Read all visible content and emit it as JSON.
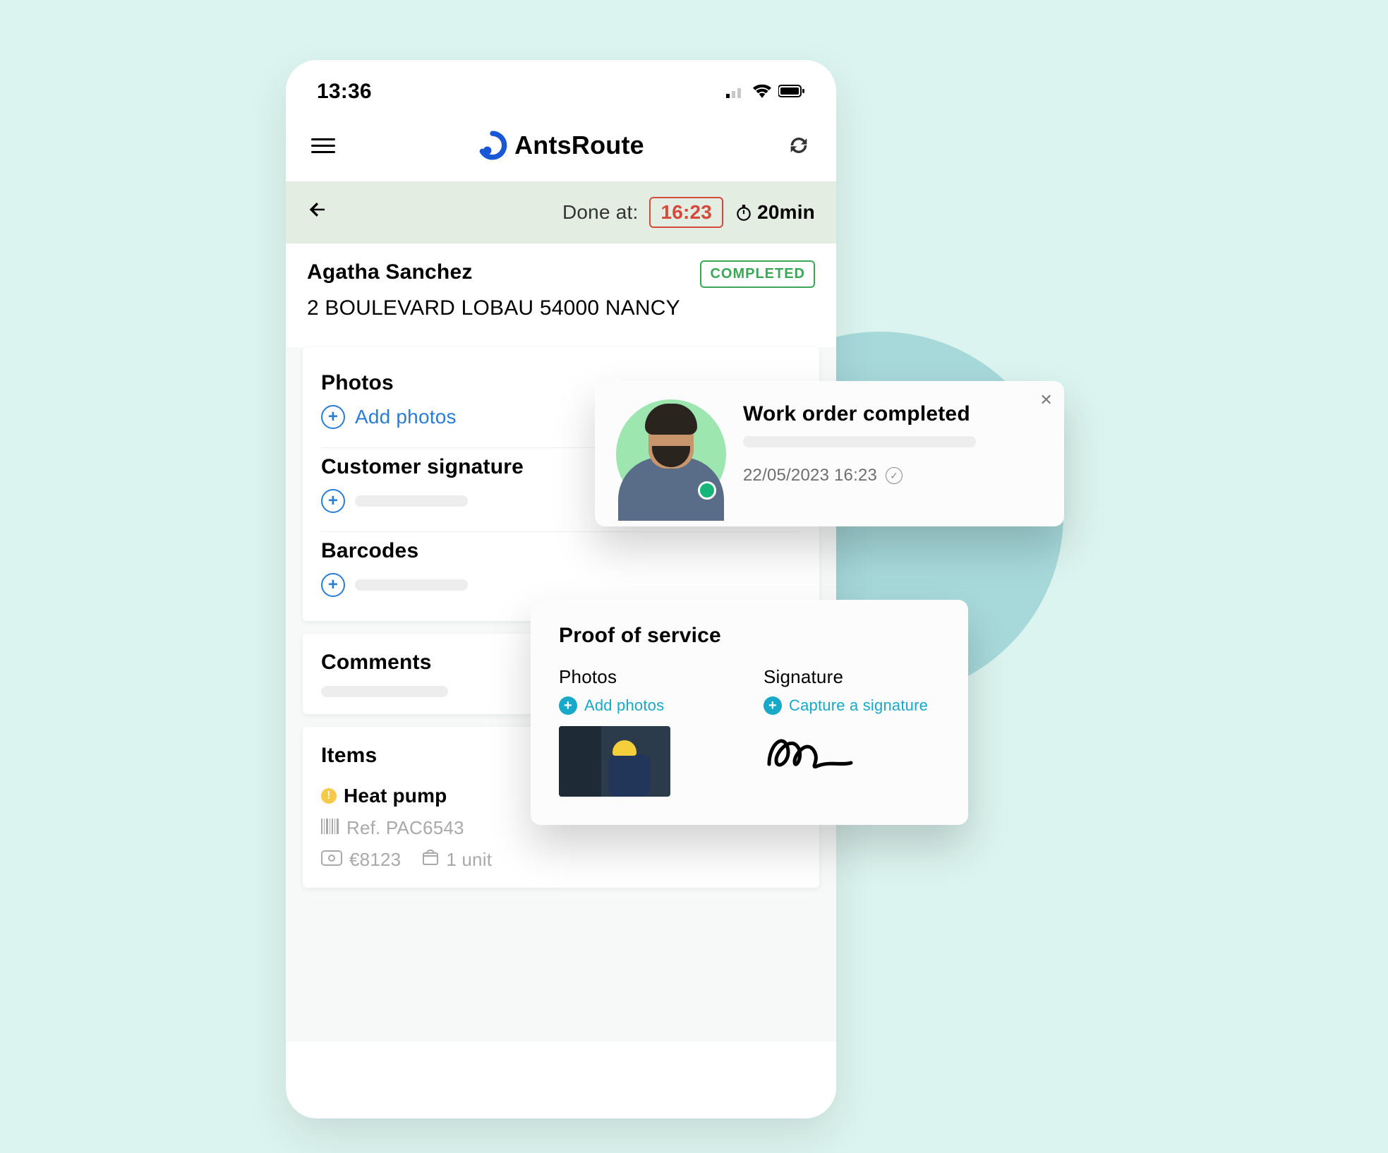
{
  "status_bar": {
    "time": "13:36"
  },
  "brand": "AntsRoute",
  "done_bar": {
    "label": "Done at:",
    "time": "16:23",
    "duration": "20min"
  },
  "customer": {
    "name": "Agatha Sanchez",
    "address": "2 BOULEVARD LOBAU 54000 NANCY",
    "status_badge": "COMPLETED"
  },
  "sections": {
    "photos": {
      "title": "Photos",
      "action": "Add photos"
    },
    "signature": {
      "title": "Customer signature"
    },
    "barcodes": {
      "title": "Barcodes"
    },
    "comments": {
      "title": "Comments"
    },
    "items": {
      "title": "Items"
    }
  },
  "item": {
    "name": "Heat pump",
    "ref": "Ref. PAC6543",
    "price": "€8123",
    "units": "1 unit"
  },
  "toast": {
    "title": "Work order completed",
    "timestamp": "22/05/2023 16:23"
  },
  "proof": {
    "title": "Proof of service",
    "photos": {
      "title": "Photos",
      "action": "Add photos"
    },
    "signature": {
      "title": "Signature",
      "action": "Capture a signature"
    }
  }
}
